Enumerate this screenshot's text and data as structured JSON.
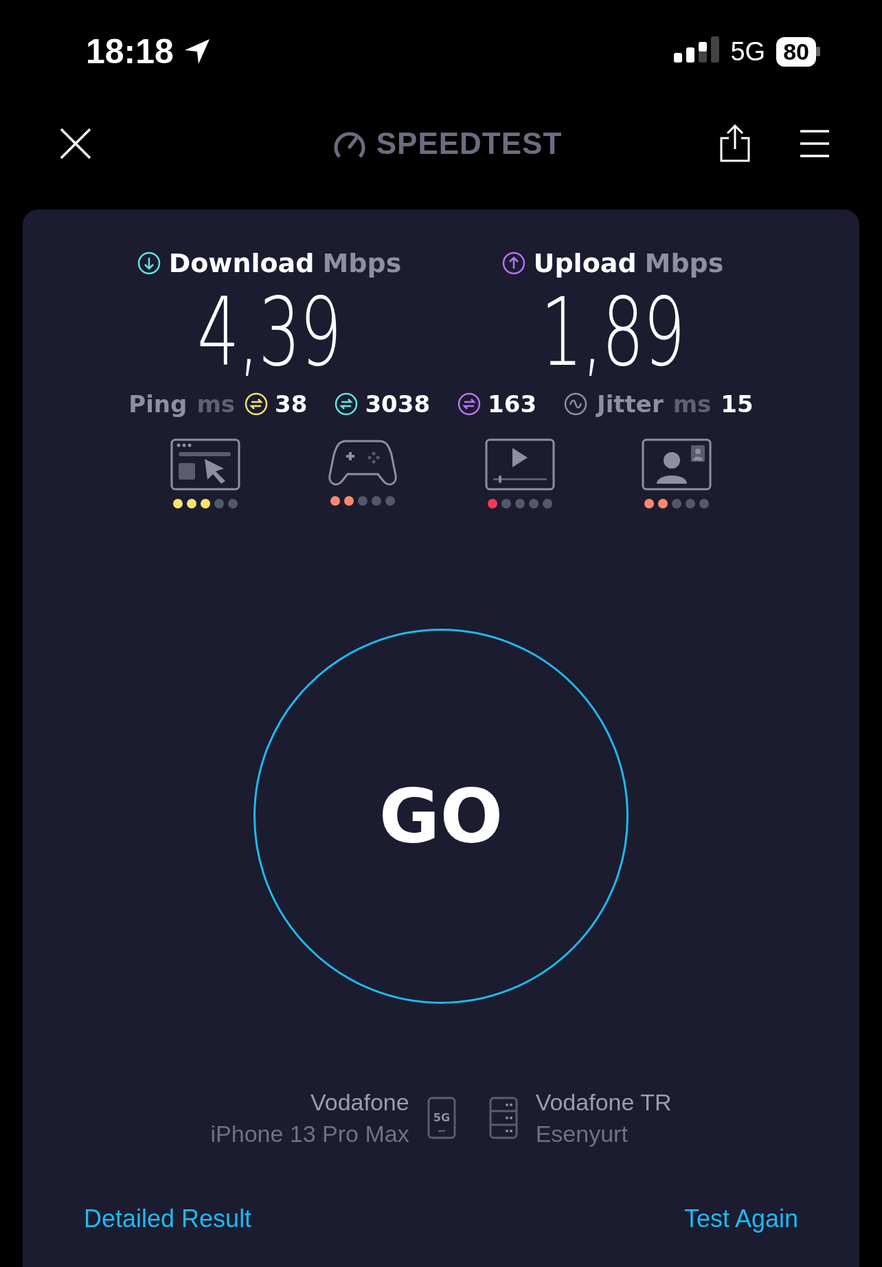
{
  "status_bar": {
    "time": "18:18",
    "network": "5G",
    "battery": "80"
  },
  "header": {
    "logo": "SPEEDTEST"
  },
  "results": [
    {
      "kind": "download",
      "label": "Download",
      "unit": "Mbps",
      "value": "4,39",
      "color": "#5ee6e0"
    },
    {
      "kind": "upload",
      "label": "Upload",
      "unit": "Mbps",
      "value": "1,89",
      "color": "#b873f5"
    }
  ],
  "latency": {
    "ping_label": "Ping",
    "ping_unit": "ms",
    "readings": [
      {
        "value": "38",
        "color": "#f5e36c"
      },
      {
        "value": "3038",
        "color": "#5ee6e0"
      },
      {
        "value": "163",
        "color": "#b873f5"
      }
    ],
    "jitter_label": "Jitter",
    "jitter_unit": "ms",
    "jitter_value": "15"
  },
  "quality": [
    {
      "kind": "browsing",
      "stars": 3,
      "color": "#f5e36c"
    },
    {
      "kind": "gaming",
      "stars": 2,
      "color": "#fb8a6b"
    },
    {
      "kind": "streaming",
      "stars": 1,
      "color": "#f7365f"
    },
    {
      "kind": "video_call",
      "stars": 2,
      "color": "#fb8a6b"
    }
  ],
  "go_button": "GO",
  "connection": {
    "provider": "Vodafone",
    "device": "iPhone 13 Pro Max",
    "network_badge": "5G",
    "server": "Vodafone TR",
    "location": "Esenyurt"
  },
  "links": [
    "Detailed Result",
    "Test Again"
  ]
}
